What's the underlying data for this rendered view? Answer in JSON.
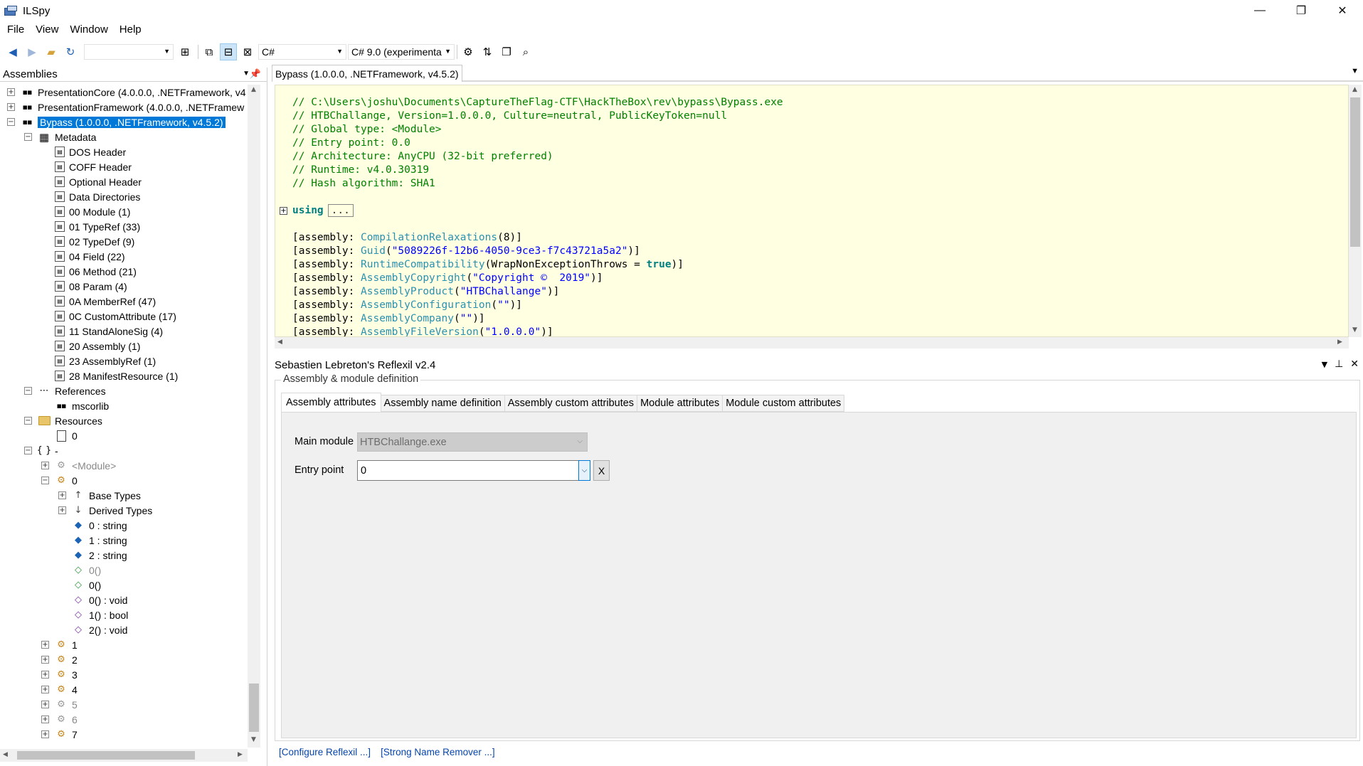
{
  "window": {
    "title": "ILSpy",
    "controls": [
      "—",
      "❐",
      "✕"
    ]
  },
  "menu": [
    "File",
    "View",
    "Window",
    "Help"
  ],
  "toolbar": {
    "search_value": "",
    "language": "C#",
    "language_version": "C# 9.0 (experimenta"
  },
  "assemblies_panel": {
    "title": "Assemblies",
    "tree": [
      {
        "indent": 0,
        "exp": "+",
        "icon": "asm",
        "label": "PresentationCore (4.0.0.0, .NETFramework, v4"
      },
      {
        "indent": 0,
        "exp": "+",
        "icon": "asm",
        "label": "PresentationFramework (4.0.0.0, .NETFramew"
      },
      {
        "indent": 0,
        "exp": "−",
        "icon": "asm",
        "label": "Bypass (1.0.0.0, .NETFramework, v4.5.2)",
        "selected": true
      },
      {
        "indent": 1,
        "exp": "−",
        "icon": "meta",
        "label": "Metadata"
      },
      {
        "indent": 2,
        "exp": "",
        "icon": "table",
        "label": "DOS Header"
      },
      {
        "indent": 2,
        "exp": "",
        "icon": "table",
        "label": "COFF Header"
      },
      {
        "indent": 2,
        "exp": "",
        "icon": "table",
        "label": "Optional Header"
      },
      {
        "indent": 2,
        "exp": "",
        "icon": "table",
        "label": "Data Directories"
      },
      {
        "indent": 2,
        "exp": "",
        "icon": "table",
        "label": "00 Module (1)"
      },
      {
        "indent": 2,
        "exp": "",
        "icon": "table",
        "label": "01 TypeRef (33)"
      },
      {
        "indent": 2,
        "exp": "",
        "icon": "table",
        "label": "02 TypeDef (9)"
      },
      {
        "indent": 2,
        "exp": "",
        "icon": "table",
        "label": "04 Field (22)"
      },
      {
        "indent": 2,
        "exp": "",
        "icon": "table",
        "label": "06 Method (21)"
      },
      {
        "indent": 2,
        "exp": "",
        "icon": "table",
        "label": "08 Param (4)"
      },
      {
        "indent": 2,
        "exp": "",
        "icon": "table",
        "label": "0A MemberRef (47)"
      },
      {
        "indent": 2,
        "exp": "",
        "icon": "table",
        "label": "0C CustomAttribute (17)"
      },
      {
        "indent": 2,
        "exp": "",
        "icon": "table",
        "label": "11 StandAloneSig (4)"
      },
      {
        "indent": 2,
        "exp": "",
        "icon": "table",
        "label": "20 Assembly (1)"
      },
      {
        "indent": 2,
        "exp": "",
        "icon": "table",
        "label": "23 AssemblyRef (1)"
      },
      {
        "indent": 2,
        "exp": "",
        "icon": "table",
        "label": "28 ManifestResource (1)"
      },
      {
        "indent": 1,
        "exp": "−",
        "icon": "ref",
        "label": "References"
      },
      {
        "indent": 2,
        "exp": "",
        "icon": "asm",
        "label": "mscorlib"
      },
      {
        "indent": 1,
        "exp": "−",
        "icon": "folder",
        "label": "Resources"
      },
      {
        "indent": 2,
        "exp": "",
        "icon": "file",
        "label": "0"
      },
      {
        "indent": 1,
        "exp": "−",
        "icon": "ns",
        "label": "-"
      },
      {
        "indent": 2,
        "exp": "+",
        "icon": "cls",
        "label": "<Module>",
        "grey": true
      },
      {
        "indent": 2,
        "exp": "−",
        "icon": "cls",
        "label": "0"
      },
      {
        "indent": 3,
        "exp": "+",
        "icon": "base",
        "label": "Base Types"
      },
      {
        "indent": 3,
        "exp": "+",
        "icon": "derived",
        "label": "Derived Types"
      },
      {
        "indent": 3,
        "exp": "",
        "icon": "field",
        "label": "0 : string"
      },
      {
        "indent": 3,
        "exp": "",
        "icon": "field",
        "label": "1 : string"
      },
      {
        "indent": 3,
        "exp": "",
        "icon": "field",
        "label": "2 : string"
      },
      {
        "indent": 3,
        "exp": "",
        "icon": "ctor",
        "label": "0()",
        "grey": true
      },
      {
        "indent": 3,
        "exp": "",
        "icon": "ctor",
        "label": "0()"
      },
      {
        "indent": 3,
        "exp": "",
        "icon": "method",
        "label": "0() : void"
      },
      {
        "indent": 3,
        "exp": "",
        "icon": "method",
        "label": "1() : bool"
      },
      {
        "indent": 3,
        "exp": "",
        "icon": "method",
        "label": "2() : void"
      },
      {
        "indent": 2,
        "exp": "+",
        "icon": "cls",
        "label": "1"
      },
      {
        "indent": 2,
        "exp": "+",
        "icon": "cls",
        "label": "2"
      },
      {
        "indent": 2,
        "exp": "+",
        "icon": "cls",
        "label": "3"
      },
      {
        "indent": 2,
        "exp": "+",
        "icon": "cls",
        "label": "4"
      },
      {
        "indent": 2,
        "exp": "+",
        "icon": "cls",
        "label": "5",
        "grey": true
      },
      {
        "indent": 2,
        "exp": "+",
        "icon": "cls",
        "label": "6",
        "grey": true
      },
      {
        "indent": 2,
        "exp": "+",
        "icon": "cls",
        "label": "7"
      }
    ]
  },
  "document": {
    "tab_title": "Bypass (1.0.0.0, .NETFramework, v4.5.2)",
    "code_lines": [
      [
        [
          "c-cmt",
          "// C:\\Users\\joshu\\Documents\\CaptureTheFlag-CTF\\HackTheBox\\rev\\bypass\\Bypass.exe"
        ]
      ],
      [
        [
          "c-cmt",
          "// HTBChallange, Version=1.0.0.0, Culture=neutral, PublicKeyToken=null"
        ]
      ],
      [
        [
          "c-cmt",
          "// Global type: <Module>"
        ]
      ],
      [
        [
          "c-cmt",
          "// Entry point: 0.0"
        ]
      ],
      [
        [
          "c-cmt",
          "// Architecture: AnyCPU (32-bit preferred)"
        ]
      ],
      [
        [
          "c-cmt",
          "// Runtime: v4.0.30319"
        ]
      ],
      [
        [
          "c-cmt",
          "// Hash algorithm: SHA1"
        ]
      ],
      [],
      [
        [
          "c-kw",
          "using"
        ],
        [
          "ellipsis-box",
          "..."
        ]
      ],
      [],
      [
        [
          "",
          "[assembly: "
        ],
        [
          "c-attr",
          "CompilationRelaxations"
        ],
        [
          "",
          "(8)]"
        ]
      ],
      [
        [
          "",
          "[assembly: "
        ],
        [
          "c-attr",
          "Guid"
        ],
        [
          "",
          "("
        ],
        [
          "c-str",
          "\"5089226f-12b6-4050-9ce3-f7c43721a5a2\""
        ],
        [
          "",
          ")]"
        ]
      ],
      [
        [
          "",
          "[assembly: "
        ],
        [
          "c-attr",
          "RuntimeCompatibility"
        ],
        [
          "",
          "(WrapNonExceptionThrows = "
        ],
        [
          "c-bool",
          "true"
        ],
        [
          "",
          ")]"
        ]
      ],
      [
        [
          "",
          "[assembly: "
        ],
        [
          "c-attr",
          "AssemblyCopyright"
        ],
        [
          "",
          "("
        ],
        [
          "c-str",
          "\"Copyright ©  2019\""
        ],
        [
          "",
          ")]"
        ]
      ],
      [
        [
          "",
          "[assembly: "
        ],
        [
          "c-attr",
          "AssemblyProduct"
        ],
        [
          "",
          "("
        ],
        [
          "c-str",
          "\"HTBChallange\""
        ],
        [
          "",
          ")]"
        ]
      ],
      [
        [
          "",
          "[assembly: "
        ],
        [
          "c-attr",
          "AssemblyConfiguration"
        ],
        [
          "",
          "("
        ],
        [
          "c-str",
          "\"\""
        ],
        [
          "",
          ")]"
        ]
      ],
      [
        [
          "",
          "[assembly: "
        ],
        [
          "c-attr",
          "AssemblyCompany"
        ],
        [
          "",
          "("
        ],
        [
          "c-str",
          "\"\""
        ],
        [
          "",
          ")]"
        ]
      ],
      [
        [
          "",
          "[assembly: "
        ],
        [
          "c-attr",
          "AssemblyFileVersion"
        ],
        [
          "",
          "("
        ],
        [
          "c-str",
          "\"1.0.0.0\""
        ],
        [
          "",
          ")]"
        ]
      ]
    ]
  },
  "reflexil": {
    "title": "Sebastien Lebreton's Reflexil v2.4",
    "group_title": "Assembly & module definition",
    "tabs": [
      "Assembly attributes",
      "Assembly name definition",
      "Assembly custom attributes",
      "Module attributes",
      "Module custom attributes"
    ],
    "main_module_label": "Main module",
    "main_module_value": "HTBChallange.exe",
    "entry_point_label": "Entry point",
    "entry_point_value": "0",
    "x_button": "X",
    "links": [
      "[Configure Reflexil ...]",
      "[Strong Name Remover ...]"
    ]
  }
}
